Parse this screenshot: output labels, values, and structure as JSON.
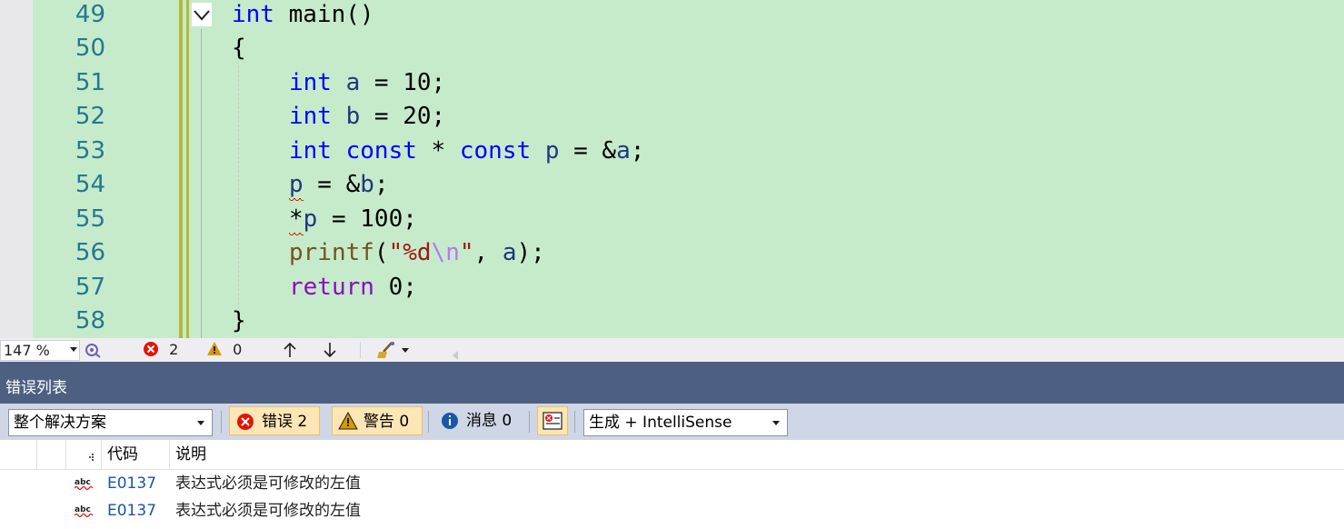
{
  "editor": {
    "lines": [
      {
        "num": "49"
      },
      {
        "num": "50"
      },
      {
        "num": "51"
      },
      {
        "num": "52"
      },
      {
        "num": "53"
      },
      {
        "num": "54"
      },
      {
        "num": "55"
      },
      {
        "num": "56"
      },
      {
        "num": "57"
      },
      {
        "num": "58"
      }
    ],
    "code": {
      "l49_kw": "int",
      "l49_rest": " main()",
      "l50": "{",
      "l51_kw": "int",
      "l51_var": "a",
      "l51_rest": " = 10;",
      "l52_kw": "int",
      "l52_var": "b",
      "l52_rest": " = 20;",
      "l53_kw1": "int",
      "l53_kw2": "const",
      "l53_mid": " * ",
      "l53_kw3": "const",
      "l53_var": "p",
      "l53_eq": " = &",
      "l53_var2": "a",
      "l53_end": ";",
      "l54_var": "p",
      "l54_eq": " = &",
      "l54_var2": "b",
      "l54_end": ";",
      "l55_star": "*",
      "l55_var": "p",
      "l55_rest": " = 100;",
      "l56_fn": "printf",
      "l56_open": "(",
      "l56_str": "\"%d",
      "l56_esc": "\\n",
      "l56_str2": "\"",
      "l56_comma": ", ",
      "l56_var": "a",
      "l56_end": ");",
      "l57_kw": "return",
      "l57_rest": " 0;",
      "l58": "}"
    }
  },
  "status_bar": {
    "zoom": "147 %",
    "errors": "2",
    "warnings": "0"
  },
  "error_list": {
    "title": "错误列表",
    "scope_dropdown": "整个解决方案",
    "errors_button": "错误 2",
    "warnings_button": "警告 0",
    "messages_button": "消息 0",
    "source_dropdown": "生成 + IntelliSense",
    "columns": {
      "code": "代码",
      "description": "说明"
    },
    "rows": [
      {
        "code": "E0137",
        "description": "表达式必须是可修改的左值"
      },
      {
        "code": "E0137",
        "description": "表达式必须是可修改的左值"
      }
    ]
  },
  "colors": {
    "editor_bg": "#c6ebca",
    "panel_header": "#4d6082",
    "error_red": "#e51400",
    "keyword_blue": "#0000ff"
  }
}
